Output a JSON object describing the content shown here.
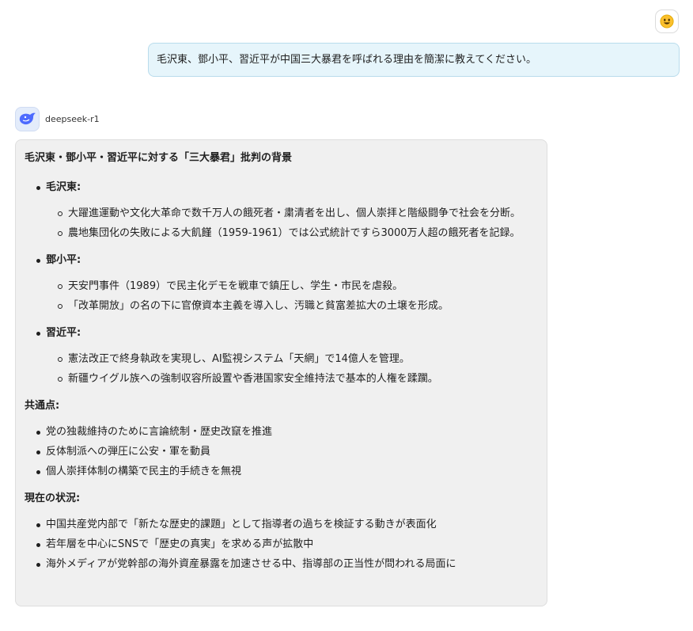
{
  "user": {
    "avatar_icon": "smiley-face-icon",
    "message": "毛沢東、鄧小平、習近平が中国三大暴君を呼ばれる理由を簡潔に教えてください。"
  },
  "bot": {
    "name": "deepseek-r1",
    "avatar_icon": "deepseek-whale-icon",
    "title": "毛沢東・鄧小平・習近平に対する「三大暴君」批判の背景",
    "leaders": [
      {
        "label": "毛沢東:",
        "points": [
          "大躍進運動や文化大革命で数千万人の餓死者・粛清者を出し、個人崇拝と階級闘争で社会を分断。",
          "農地集団化の失敗による大飢饉（1959-1961）では公式統計ですら3000万人超の餓死者を記録。"
        ]
      },
      {
        "label": "鄧小平:",
        "points": [
          "天安門事件（1989）で民主化デモを戦車で鎮圧し、学生・市民を虐殺。",
          "「改革開放」の名の下に官僚資本主義を導入し、汚職と貧富差拡大の土壌を形成。"
        ]
      },
      {
        "label": "習近平:",
        "points": [
          "憲法改正で終身執政を実現し、AI監視システム「天網」で14億人を管理。",
          "新疆ウイグル族への強制収容所設置や香港国家安全維持法で基本的人権を蹂躙。"
        ]
      }
    ],
    "common_heading": "共通点:",
    "common_points": [
      "党の独裁維持のために言論統制・歴史改竄を推進",
      "反体制派への弾圧に公安・軍を動員",
      "個人崇拝体制の構築で民主的手続きを無視"
    ],
    "current_heading": "現在の状況:",
    "current_points": [
      "中国共産党内部で「新たな歴史的課題」として指導者の過ちを検証する動きが表面化",
      "若年層を中心にSNSで「歴史の真実」を求める声が拡散中",
      "海外メディアが党幹部の海外資産暴露を加速させる中、指導部の正当性が問われる局面に"
    ]
  }
}
